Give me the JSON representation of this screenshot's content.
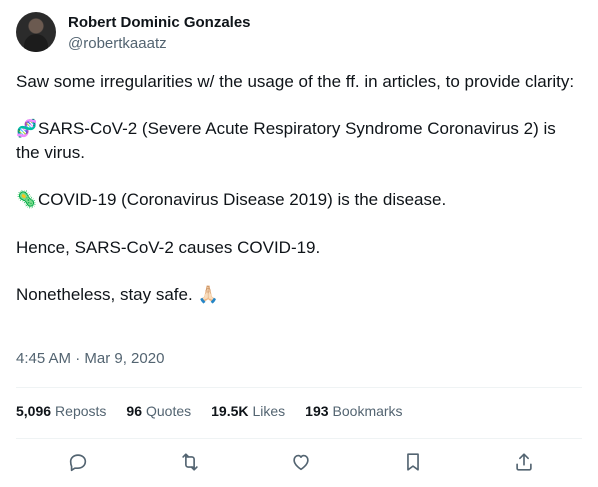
{
  "author": {
    "name": "Robert Dominic Gonzales",
    "handle": "@robertkaaatz"
  },
  "tweet": {
    "intro": "Saw some irregularities w/ the usage of the ff. in articles, to provide clarity:",
    "virus_emoji": "🧬",
    "virus_line": "SARS-CoV-2 (Severe Acute Respiratory Syndrome Coronavirus 2) is the virus.",
    "disease_emoji": "🦠",
    "disease_line": "COVID-19 (Coronavirus Disease 2019) is the disease.",
    "hence": "Hence, SARS-CoV-2 causes COVID-19.",
    "closing": "Nonetheless, stay safe.",
    "closing_emoji": "🙏🏻",
    "timestamp": "4:45 AM · Mar 9, 2020"
  },
  "stats": {
    "reposts_count": "5,096",
    "reposts_label": "Reposts",
    "quotes_count": "96",
    "quotes_label": "Quotes",
    "likes_count": "19.5K",
    "likes_label": "Likes",
    "bookmarks_count": "193",
    "bookmarks_label": "Bookmarks"
  },
  "actions": {
    "reply_icon": "reply-icon",
    "repost_icon": "repost-icon",
    "like_icon": "like-icon",
    "bookmark_icon": "bookmark-icon",
    "share_icon": "share-icon"
  },
  "colors": {
    "text": "#0f1419",
    "secondary": "#536471",
    "divider": "#eff3f4"
  }
}
